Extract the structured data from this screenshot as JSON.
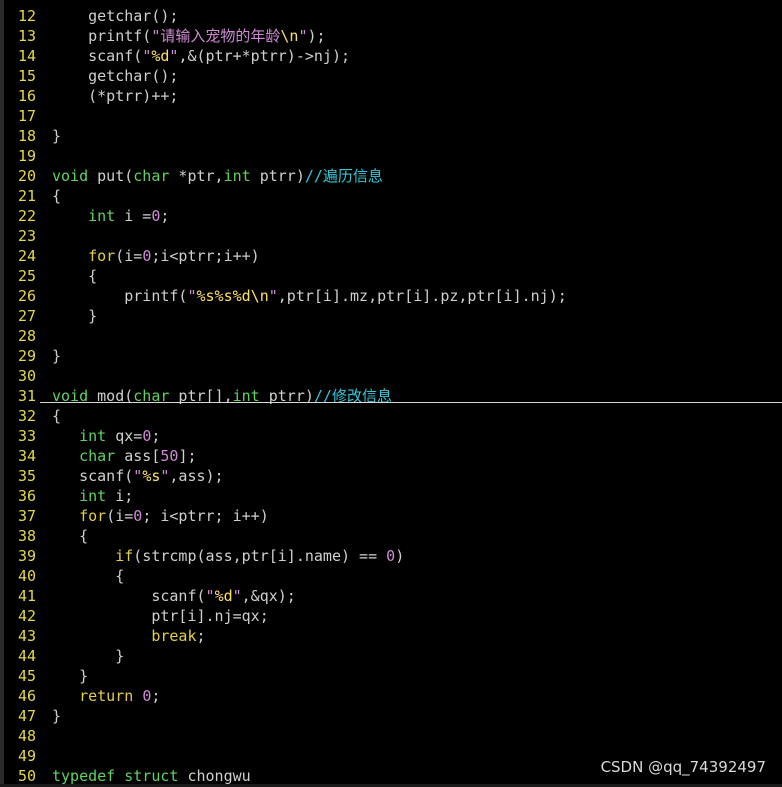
{
  "editor": {
    "lines": [
      {
        "n": "12",
        "tokens": [
          {
            "t": "    getchar();",
            "c": "p"
          }
        ]
      },
      {
        "n": "13",
        "tokens": [
          {
            "t": "    printf(",
            "c": "p"
          },
          {
            "t": "\"请输入宠物的年龄",
            "c": "s"
          },
          {
            "t": "\\n",
            "c": "esc"
          },
          {
            "t": "\"",
            "c": "s"
          },
          {
            "t": ");",
            "c": "p"
          }
        ]
      },
      {
        "n": "14",
        "tokens": [
          {
            "t": "    scanf(",
            "c": "p"
          },
          {
            "t": "\"",
            "c": "s"
          },
          {
            "t": "%d",
            "c": "esc"
          },
          {
            "t": "\"",
            "c": "s"
          },
          {
            "t": ",&(ptr+*ptrr)->nj);",
            "c": "p"
          }
        ]
      },
      {
        "n": "15",
        "tokens": [
          {
            "t": "    getchar();",
            "c": "p"
          }
        ]
      },
      {
        "n": "16",
        "tokens": [
          {
            "t": "    (*ptrr)++;",
            "c": "p"
          }
        ]
      },
      {
        "n": "17",
        "tokens": []
      },
      {
        "n": "18",
        "tokens": [
          {
            "t": "}",
            "c": "p"
          }
        ]
      },
      {
        "n": "19",
        "tokens": []
      },
      {
        "n": "20",
        "tokens": [
          {
            "t": "void",
            "c": "ty"
          },
          {
            "t": " put(",
            "c": "p"
          },
          {
            "t": "char",
            "c": "ty"
          },
          {
            "t": " *ptr,",
            "c": "p"
          },
          {
            "t": "int",
            "c": "ty"
          },
          {
            "t": " ptrr)",
            "c": "p"
          },
          {
            "t": "//遍历信息",
            "c": "c"
          }
        ]
      },
      {
        "n": "21",
        "tokens": [
          {
            "t": "{",
            "c": "p"
          }
        ]
      },
      {
        "n": "22",
        "tokens": [
          {
            "t": "    ",
            "c": "p"
          },
          {
            "t": "int",
            "c": "ty"
          },
          {
            "t": " i =",
            "c": "p"
          },
          {
            "t": "0",
            "c": "n"
          },
          {
            "t": ";",
            "c": "p"
          }
        ]
      },
      {
        "n": "23",
        "tokens": []
      },
      {
        "n": "24",
        "tokens": [
          {
            "t": "    ",
            "c": "p"
          },
          {
            "t": "for",
            "c": "k"
          },
          {
            "t": "(i=",
            "c": "p"
          },
          {
            "t": "0",
            "c": "n"
          },
          {
            "t": ";i<ptrr;i++)",
            "c": "p"
          }
        ]
      },
      {
        "n": "25",
        "tokens": [
          {
            "t": "    {",
            "c": "p"
          }
        ]
      },
      {
        "n": "26",
        "tokens": [
          {
            "t": "        printf(",
            "c": "p"
          },
          {
            "t": "\"",
            "c": "s"
          },
          {
            "t": "%s%s%d\\n",
            "c": "esc"
          },
          {
            "t": "\"",
            "c": "s"
          },
          {
            "t": ",ptr[i].mz,ptr[i].pz,ptr[i].nj);",
            "c": "p"
          }
        ]
      },
      {
        "n": "27",
        "tokens": [
          {
            "t": "    }",
            "c": "p"
          }
        ]
      },
      {
        "n": "28",
        "tokens": []
      },
      {
        "n": "29",
        "tokens": [
          {
            "t": "}",
            "c": "p"
          }
        ]
      },
      {
        "n": "30",
        "tokens": []
      },
      {
        "n": "31",
        "tokens": [
          {
            "t": "void",
            "c": "ty"
          },
          {
            "t": " mod(",
            "c": "p"
          },
          {
            "t": "char",
            "c": "ty"
          },
          {
            "t": " ptr[],",
            "c": "p"
          },
          {
            "t": "int",
            "c": "ty"
          },
          {
            "t": " ptrr)",
            "c": "p"
          },
          {
            "t": "//修改信息",
            "c": "c"
          }
        ],
        "cursor": true
      },
      {
        "n": "32",
        "tokens": [
          {
            "t": "{",
            "c": "p"
          }
        ]
      },
      {
        "n": "33",
        "tokens": [
          {
            "t": "   ",
            "c": "p"
          },
          {
            "t": "int",
            "c": "ty"
          },
          {
            "t": " qx=",
            "c": "p"
          },
          {
            "t": "0",
            "c": "n"
          },
          {
            "t": ";",
            "c": "p"
          }
        ]
      },
      {
        "n": "34",
        "tokens": [
          {
            "t": "   ",
            "c": "p"
          },
          {
            "t": "char",
            "c": "ty"
          },
          {
            "t": " ass[",
            "c": "p"
          },
          {
            "t": "50",
            "c": "n"
          },
          {
            "t": "];",
            "c": "p"
          }
        ]
      },
      {
        "n": "35",
        "tokens": [
          {
            "t": "   scanf(",
            "c": "p"
          },
          {
            "t": "\"",
            "c": "s"
          },
          {
            "t": "%s",
            "c": "esc"
          },
          {
            "t": "\"",
            "c": "s"
          },
          {
            "t": ",ass);",
            "c": "p"
          }
        ]
      },
      {
        "n": "36",
        "tokens": [
          {
            "t": "   ",
            "c": "p"
          },
          {
            "t": "int",
            "c": "ty"
          },
          {
            "t": " i;",
            "c": "p"
          }
        ]
      },
      {
        "n": "37",
        "tokens": [
          {
            "t": "   ",
            "c": "p"
          },
          {
            "t": "for",
            "c": "k"
          },
          {
            "t": "(i=",
            "c": "p"
          },
          {
            "t": "0",
            "c": "n"
          },
          {
            "t": "; i<ptrr; i++)",
            "c": "p"
          }
        ]
      },
      {
        "n": "38",
        "tokens": [
          {
            "t": "   {",
            "c": "p"
          }
        ]
      },
      {
        "n": "39",
        "tokens": [
          {
            "t": "       ",
            "c": "p"
          },
          {
            "t": "if",
            "c": "k"
          },
          {
            "t": "(strcmp(ass,ptr[i].name) == ",
            "c": "p"
          },
          {
            "t": "0",
            "c": "n"
          },
          {
            "t": ")",
            "c": "p"
          }
        ]
      },
      {
        "n": "40",
        "tokens": [
          {
            "t": "       {",
            "c": "p"
          }
        ]
      },
      {
        "n": "41",
        "tokens": [
          {
            "t": "           scanf(",
            "c": "p"
          },
          {
            "t": "\"",
            "c": "s"
          },
          {
            "t": "%d",
            "c": "esc"
          },
          {
            "t": "\"",
            "c": "s"
          },
          {
            "t": ",&qx);",
            "c": "p"
          }
        ]
      },
      {
        "n": "42",
        "tokens": [
          {
            "t": "           ptr[i].nj=qx;",
            "c": "p"
          }
        ]
      },
      {
        "n": "43",
        "tokens": [
          {
            "t": "           ",
            "c": "p"
          },
          {
            "t": "break",
            "c": "k"
          },
          {
            "t": ";",
            "c": "p"
          }
        ]
      },
      {
        "n": "44",
        "tokens": [
          {
            "t": "       }",
            "c": "p"
          }
        ]
      },
      {
        "n": "45",
        "tokens": [
          {
            "t": "   }",
            "c": "p"
          }
        ]
      },
      {
        "n": "46",
        "tokens": [
          {
            "t": "   ",
            "c": "p"
          },
          {
            "t": "return",
            "c": "k"
          },
          {
            "t": " ",
            "c": "p"
          },
          {
            "t": "0",
            "c": "n"
          },
          {
            "t": ";",
            "c": "p"
          }
        ]
      },
      {
        "n": "47",
        "tokens": [
          {
            "t": "}",
            "c": "p"
          }
        ]
      },
      {
        "n": "48",
        "tokens": []
      },
      {
        "n": "49",
        "tokens": []
      },
      {
        "n": "50",
        "tokens": [
          {
            "t": "typedef",
            "c": "ty"
          },
          {
            "t": " ",
            "c": "p"
          },
          {
            "t": "struct",
            "c": "ty"
          },
          {
            "t": " chongwu",
            "c": "p"
          }
        ]
      }
    ]
  },
  "watermark": "CSDN @qq_74392497",
  "colors": {
    "background": "#000000",
    "line_number": "#e5d94a",
    "type": "#5fd35f",
    "keyword": "#e3cf43",
    "string": "#d08ad6",
    "comment": "#37c7d9"
  }
}
